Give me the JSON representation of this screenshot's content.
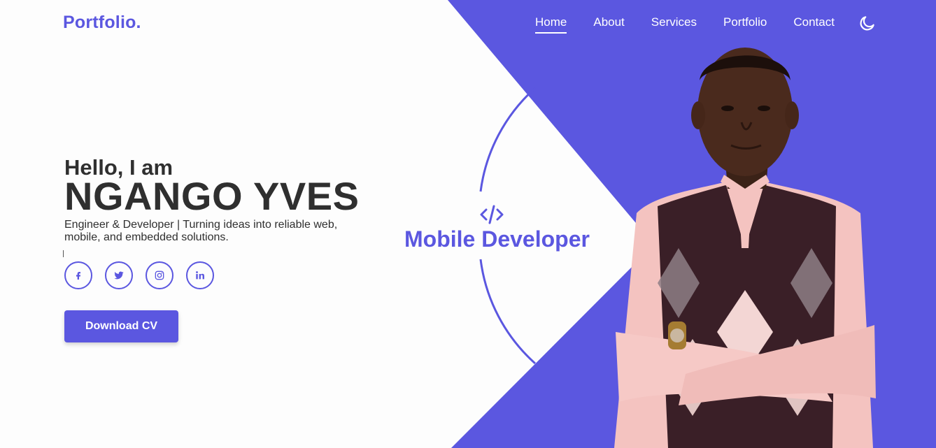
{
  "brand": {
    "logo": "Portfolio."
  },
  "nav": {
    "items": [
      {
        "label": "Home",
        "active": true
      },
      {
        "label": "About",
        "active": false
      },
      {
        "label": "Services",
        "active": false
      },
      {
        "label": "Portfolio",
        "active": false
      },
      {
        "label": "Contact",
        "active": false
      }
    ],
    "theme_icon": "moon-icon"
  },
  "hero": {
    "greeting": "Hello, I am",
    "name": "NGANGO YVES",
    "tagline": "Engineer & Developer | Turning ideas into reliable web, mobile, and embedded solutions.",
    "role": "Mobile Developer",
    "role_icon": "code-icon",
    "cta_label": "Download CV"
  },
  "socials": [
    {
      "icon": "facebook-icon"
    },
    {
      "icon": "twitter-icon"
    },
    {
      "icon": "instagram-icon"
    },
    {
      "icon": "linkedin-icon"
    }
  ],
  "colors": {
    "accent": "#5b57e0",
    "background": "#fdfdfd",
    "text": "#2f2f2f",
    "nav_text": "#ffffff"
  }
}
